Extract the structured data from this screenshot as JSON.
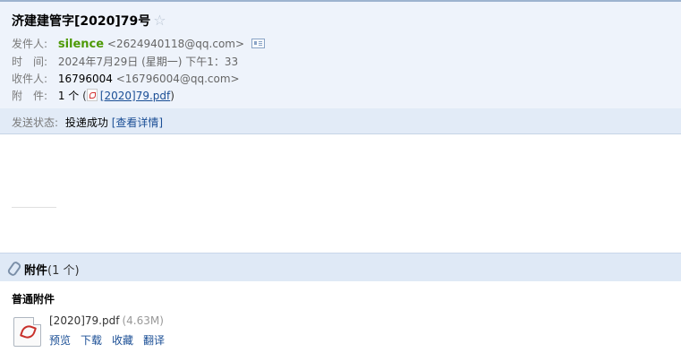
{
  "header": {
    "subject": "济建建管字[2020]79号",
    "star_icon": "star-outline-icon",
    "sender": {
      "label": "发件人:",
      "name": "silence",
      "address": "<2624940118@qq.com>",
      "card_icon": "contact-card-icon"
    },
    "time": {
      "label": "时　间:",
      "value": "2024年7月29日 (星期一) 下午1：33"
    },
    "recipient": {
      "label": "收件人:",
      "name": "16796004",
      "address": "<16796004@qq.com>"
    },
    "attachment": {
      "label": "附　件:",
      "count": "1 个",
      "open_paren": "(",
      "file_link": "[2020]79.pdf",
      "close_paren": ")"
    }
  },
  "status": {
    "label": "发送状态:",
    "value": "投递成功",
    "detail_link": "[查看详情]"
  },
  "attachments_section": {
    "title": "附件",
    "count": "(1 个)",
    "group_label": "普通附件",
    "files": [
      {
        "name": "[2020]79.pdf",
        "size": "(4.63M)",
        "actions": [
          "预览",
          "下载",
          "收藏",
          "翻译"
        ]
      }
    ]
  },
  "colors": {
    "header_bg": "#eef3fb",
    "status_bg": "#e2ebf7",
    "attachment_bar_bg": "#dfe9f6",
    "sender_name": "#4e9a06",
    "link": "#1a4e95"
  }
}
